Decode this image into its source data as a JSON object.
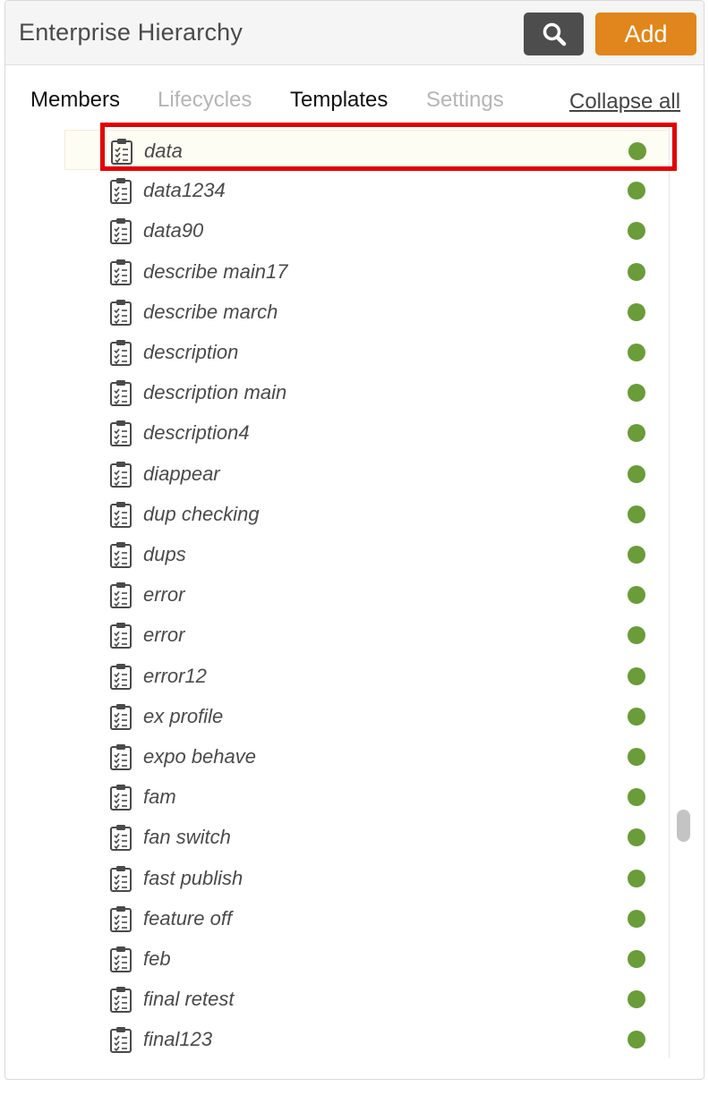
{
  "header": {
    "title": "Enterprise Hierarchy",
    "search_icon": "search-icon",
    "add_label": "Add"
  },
  "tabs": [
    {
      "label": "Members",
      "state": "active"
    },
    {
      "label": "Lifecycles",
      "state": "disabled"
    },
    {
      "label": "Templates",
      "state": "active"
    },
    {
      "label": "Settings",
      "state": "disabled"
    }
  ],
  "collapse_all": "Collapse all",
  "colors": {
    "accent": "#e0861c",
    "status_active": "#6a9c3a",
    "highlight": "#e00000"
  },
  "items": [
    {
      "label": "data",
      "icon": "clipboard-checklist-icon",
      "status": "active",
      "selected": true
    },
    {
      "label": "data1234",
      "icon": "clipboard-checklist-icon",
      "status": "active"
    },
    {
      "label": "data90",
      "icon": "clipboard-checklist-icon",
      "status": "active"
    },
    {
      "label": "describe main17",
      "icon": "clipboard-checklist-icon",
      "status": "active"
    },
    {
      "label": "describe march",
      "icon": "clipboard-checklist-icon",
      "status": "active"
    },
    {
      "label": "description",
      "icon": "clipboard-checklist-icon",
      "status": "active"
    },
    {
      "label": "description main",
      "icon": "clipboard-checklist-icon",
      "status": "active"
    },
    {
      "label": "description4",
      "icon": "clipboard-checklist-icon",
      "status": "active"
    },
    {
      "label": "diappear",
      "icon": "clipboard-checklist-icon",
      "status": "active"
    },
    {
      "label": "dup checking",
      "icon": "clipboard-checklist-icon",
      "status": "active"
    },
    {
      "label": "dups",
      "icon": "clipboard-checklist-icon",
      "status": "active"
    },
    {
      "label": "error",
      "icon": "clipboard-checklist-icon",
      "status": "active"
    },
    {
      "label": "error",
      "icon": "clipboard-checklist-icon",
      "status": "active"
    },
    {
      "label": "error12",
      "icon": "clipboard-checklist-icon",
      "status": "active"
    },
    {
      "label": "ex profile",
      "icon": "clipboard-checklist-icon",
      "status": "active"
    },
    {
      "label": "expo behave",
      "icon": "clipboard-checklist-icon",
      "status": "active"
    },
    {
      "label": "fam",
      "icon": "clipboard-checklist-icon",
      "status": "active"
    },
    {
      "label": "fan switch",
      "icon": "clipboard-checklist-icon",
      "status": "active"
    },
    {
      "label": "fast publish",
      "icon": "clipboard-checklist-icon",
      "status": "active"
    },
    {
      "label": "feature off",
      "icon": "clipboard-checklist-icon",
      "status": "active"
    },
    {
      "label": "feb",
      "icon": "clipboard-checklist-icon",
      "status": "active"
    },
    {
      "label": "final retest",
      "icon": "clipboard-checklist-icon",
      "status": "active"
    },
    {
      "label": "final123",
      "icon": "clipboard-checklist-icon",
      "status": "active"
    }
  ]
}
